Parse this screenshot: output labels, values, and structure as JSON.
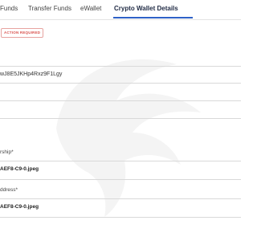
{
  "tabs": [
    {
      "label": "Funds"
    },
    {
      "label": "Transfer Funds"
    },
    {
      "label": "eWallet"
    },
    {
      "label": "Crypto Wallet Details"
    }
  ],
  "status_badge": "ACTION REQUIRED",
  "wallet_address_value": "wJ8E5JKHp4Rxz9F1Lgy",
  "ownership": {
    "label": "rship*",
    "file_name": "AEF8-C9-0.jpeg"
  },
  "address": {
    "label": "ddress*",
    "file_name": "AEF8-C9-0.jpeg"
  },
  "colors": {
    "accent": "#2f62c7",
    "badge_red": "#d9534f"
  }
}
